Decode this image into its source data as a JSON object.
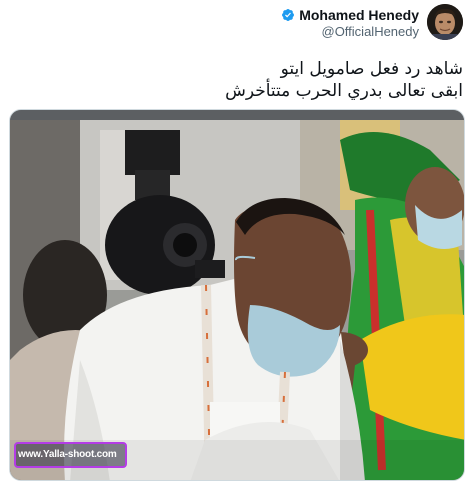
{
  "tweet": {
    "author": {
      "display_name": "Mohamed Henedy",
      "handle": "@OfficialHenedy",
      "verified_icon": "verified-badge-icon",
      "verified_color": "#1d9bf0"
    },
    "text_lines": [
      "شاهد رد فعل صامويل ايتو",
      "ابقى تعالى بدري الحرب متتأخرش"
    ],
    "media": {
      "kind": "video-frame",
      "watermark": "www.Yalla-shoot.com",
      "watermark_border_color": "#b43ce6"
    }
  }
}
